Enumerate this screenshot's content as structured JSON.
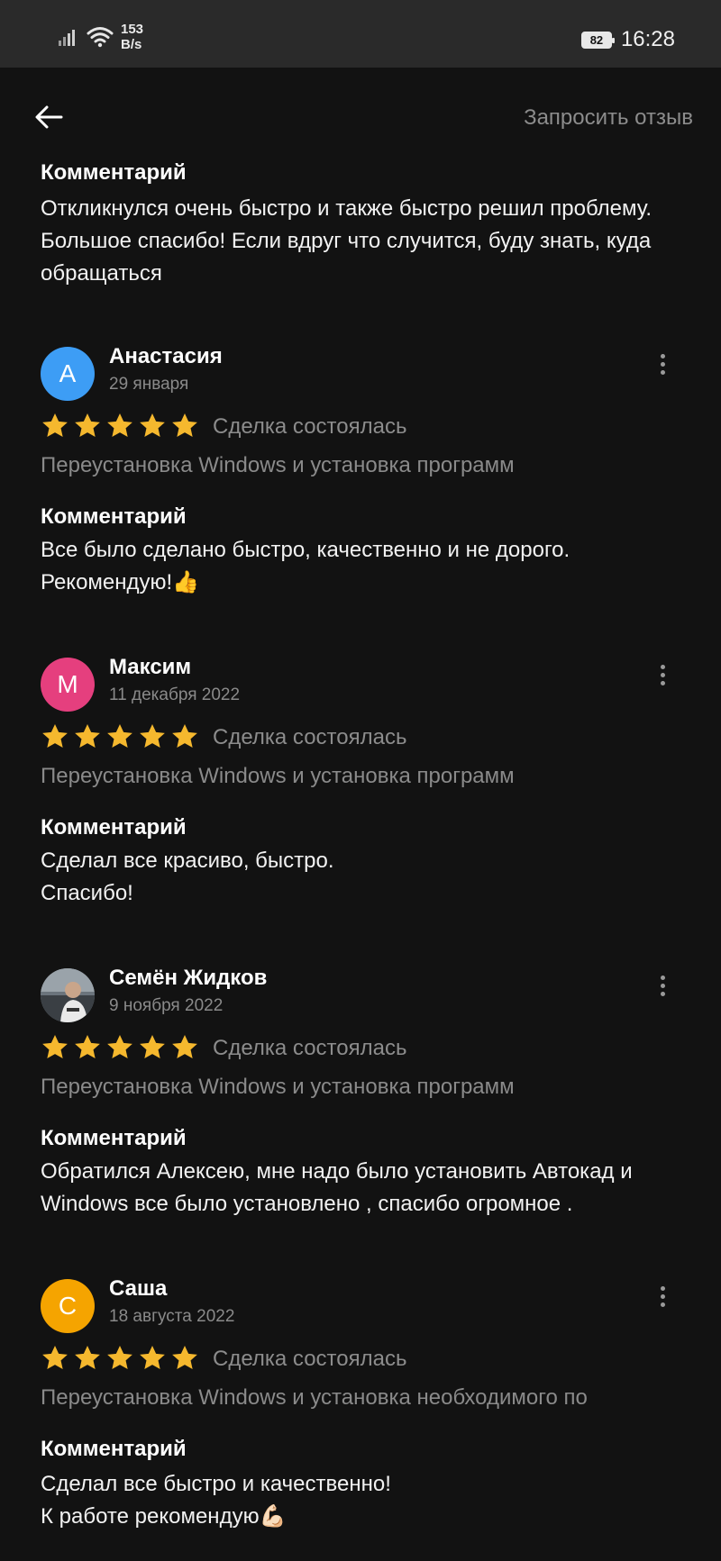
{
  "status_bar": {
    "net_speed_value": "153",
    "net_speed_unit": "B/s",
    "battery": "82",
    "time": "16:28"
  },
  "header": {
    "request_review": "Запросить отзыв"
  },
  "top_comment": {
    "label": "Комментарий",
    "text": "Откликнулся очень быстро и также быстро решил проблему. Большое спасибо! Если вдруг что случится, буду знать, куда обращаться"
  },
  "reviews": [
    {
      "initial": "А",
      "avatar_color": "#3d9df5",
      "name": "Анастасия",
      "date": "29 января",
      "rating": 5,
      "deal_status": "Сделка состоялась",
      "service": "Переустановка Windows и установка программ",
      "comment_label": "Комментарий",
      "comment_line1": "Все было сделано быстро, качественно и не дорого.",
      "comment_line2": "Рекомендую!👍"
    },
    {
      "initial": "М",
      "avatar_color": "#e53f7e",
      "name": "Максим",
      "date": "11 декабря 2022",
      "rating": 5,
      "deal_status": "Сделка состоялась",
      "service": "Переустановка Windows и установка программ",
      "comment_label": "Комментарий",
      "comment_line1": "Сделал все красиво, быстро.",
      "comment_line2": "Спасибо!"
    },
    {
      "initial": "",
      "avatar_color": "#56606a",
      "name": "Семён Жидков",
      "date": "9 ноября 2022",
      "rating": 5,
      "deal_status": "Сделка состоялась",
      "service": "Переустановка Windows и установка программ",
      "comment_label": "Комментарий",
      "comment_line1": "Обратился Алексею, мне надо было установить Автокад и",
      "comment_line2": "Windows все было установлено , спасибо огромное ."
    },
    {
      "initial": "С",
      "avatar_color": "#f5a400",
      "name": "Саша",
      "date": "18 августа 2022",
      "rating": 5,
      "deal_status": "Сделка состоялась",
      "service": "Переустановка Windows и установка необходимого по",
      "comment_label": "Комментарий",
      "comment_line1": "Сделал все быстро и качественно!",
      "comment_line2": "К работе рекомендую💪🏻"
    }
  ],
  "colors": {
    "background": "#121212",
    "star": "#f5b82e",
    "muted_text": "#8a8a8a"
  }
}
